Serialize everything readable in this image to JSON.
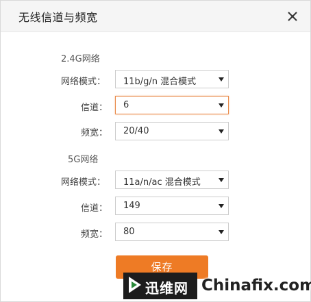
{
  "dialog": {
    "title": "无线信道与频宽",
    "close_icon": "close-icon"
  },
  "band_24g": {
    "section_label": "2.4G网络",
    "mode_label": "网络模式：",
    "mode_value": "11b/g/n 混合模式",
    "channel_label": "信道：",
    "channel_value": "6",
    "bandwidth_label": "频宽：",
    "bandwidth_value": "20/40"
  },
  "band_5g": {
    "section_label": "5G网络",
    "mode_label": "网络模式：",
    "mode_value": "11a/n/ac 混合模式",
    "channel_label": "信道：",
    "channel_value": "149",
    "bandwidth_label": "频宽：",
    "bandwidth_value": "80"
  },
  "save_label": "保存",
  "watermark": {
    "cn_text": "迅维网",
    "en_text": "Chinafix.com"
  },
  "colors": {
    "accent": "#ee7b25",
    "focus_border": "#e98b4b"
  }
}
